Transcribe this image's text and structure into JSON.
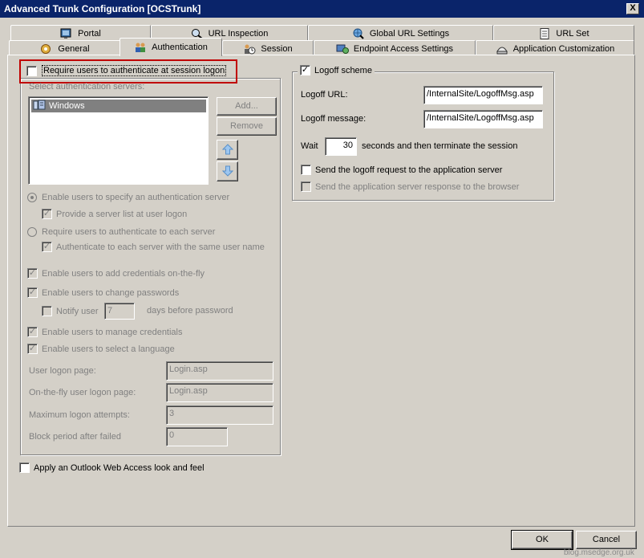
{
  "window": {
    "title": "Advanced Trunk Configuration [OCSTrunk]",
    "close_glyph": "X"
  },
  "tabs_back": [
    {
      "label": "Portal",
      "icon": "portal-icon"
    },
    {
      "label": "URL Inspection",
      "icon": "url-inspection-icon"
    },
    {
      "label": "Global URL Settings",
      "icon": "globe-search-icon"
    },
    {
      "label": "URL Set",
      "icon": "document-icon"
    }
  ],
  "tabs_front": [
    {
      "label": "General",
      "icon": "general-icon"
    },
    {
      "label": "Authentication",
      "icon": "users-icon",
      "selected": true
    },
    {
      "label": "Session",
      "icon": "session-icon"
    },
    {
      "label": "Endpoint Access Settings",
      "icon": "endpoint-icon"
    },
    {
      "label": "Application Customization",
      "icon": "app-customization-icon"
    }
  ],
  "auth": {
    "require_auth": {
      "label": "Require users to authenticate at session logon",
      "checked": false
    },
    "select_servers_label": "Select authentication servers:",
    "servers": [
      "Windows"
    ],
    "add_button": "Add...",
    "remove_button": "Remove",
    "radio_specify": {
      "label": "Enable users to specify an authentication server",
      "selected": true
    },
    "provide_list": {
      "label": "Provide a server list at user logon",
      "checked": true
    },
    "radio_each": {
      "label": "Require users to authenticate to each server",
      "selected": false
    },
    "same_user": {
      "label": "Authenticate to each server with the same user name",
      "checked": true
    },
    "add_credentials": {
      "label": "Enable users to add credentials on-the-fly",
      "checked": true
    },
    "change_passwords": {
      "label": "Enable users to change passwords",
      "checked": true
    },
    "notify_user": {
      "label": "Notify user",
      "checked": false,
      "days": "7",
      "suffix": "days before password"
    },
    "manage_credentials": {
      "label": "Enable users to manage credentials",
      "checked": true
    },
    "select_language": {
      "label": "Enable users to select a language",
      "checked": true
    },
    "user_logon_page": {
      "label": "User logon page:",
      "value": "Login.asp"
    },
    "onthefly_logon_page": {
      "label": "On-the-fly user logon page:",
      "value": "Login.asp"
    },
    "max_attempts": {
      "label": "Maximum logon attempts:",
      "value": "3"
    },
    "block_period": {
      "label": "Block period after failed",
      "value": "0"
    }
  },
  "owa_look": {
    "label": "Apply an Outlook Web Access look and feel",
    "checked": false
  },
  "logoff": {
    "scheme": {
      "label": "Logoff scheme",
      "checked": true
    },
    "url": {
      "label": "Logoff URL:",
      "value": "/InternalSite/LogoffMsg.asp"
    },
    "message": {
      "label": "Logoff message:",
      "value": "/InternalSite/LogoffMsg.asp"
    },
    "wait_label": "Wait",
    "wait_value": "30",
    "wait_suffix": "seconds and then terminate the session",
    "send_request": {
      "label": "Send the logoff request to the application server",
      "checked": false
    },
    "send_response": {
      "label": "Send the application server response to the browser",
      "checked": false
    }
  },
  "footer": {
    "ok": "OK",
    "cancel": "Cancel",
    "watermark": "blog.msedge.org.uk"
  },
  "colors": {
    "titlebar": "#0a246a",
    "highlight_box": "#c00000",
    "face": "#d4d0c8"
  }
}
